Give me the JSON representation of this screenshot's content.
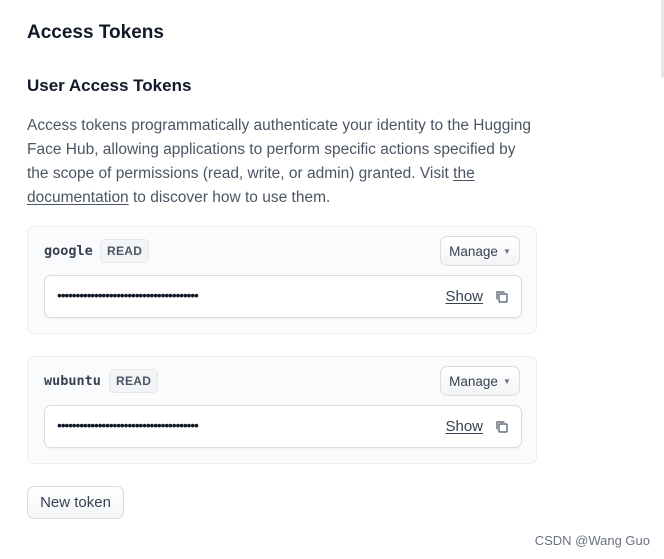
{
  "page": {
    "title": "Access Tokens"
  },
  "section": {
    "title": "User Access Tokens",
    "description_before_link": "Access tokens programmatically authenticate your identity to the Hugging Face Hub, allowing applications to perform specific actions specified by the scope of permissions (read, write, or admin) granted. Visit ",
    "link_text": "the documentation",
    "description_after_link": " to discover how to use them."
  },
  "tokens": [
    {
      "name": "google",
      "role": "READ",
      "manage_label": "Manage",
      "masked_value": "••••••••••••••••••••••••••••••••••••••",
      "show_label": "Show",
      "copy_icon": "copy-icon"
    },
    {
      "name": "wubuntu",
      "role": "READ",
      "manage_label": "Manage",
      "masked_value": "••••••••••••••••••••••••••••••••••••••",
      "show_label": "Show",
      "copy_icon": "copy-icon"
    }
  ],
  "new_token_label": "New token",
  "watermark": "CSDN @Wang Guo"
}
